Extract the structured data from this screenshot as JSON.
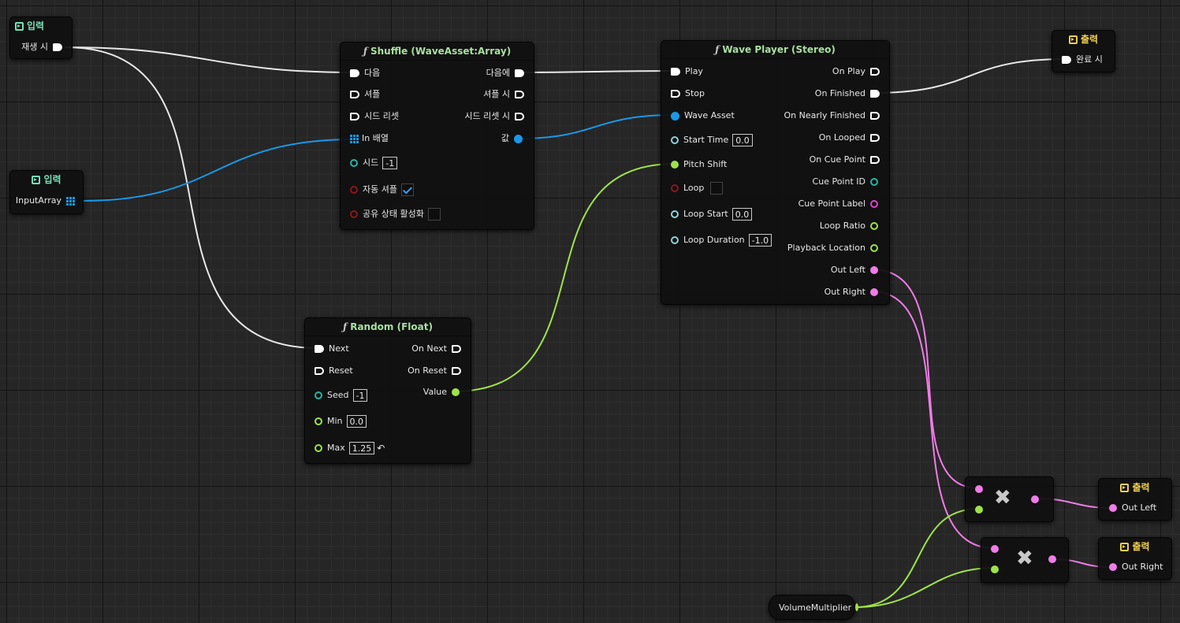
{
  "colors": {
    "exec": "#ffffff",
    "float": "#9ee24a",
    "audio": "#f07ce8",
    "wave_asset": "#1a98e8",
    "time": "#8cd2dc",
    "int": "#27b5a8",
    "bool": "#8c1818",
    "string": "#e040c8"
  },
  "input_play": {
    "title": "입력",
    "pin": "재생 시"
  },
  "input_array": {
    "title": "입력",
    "pin": "InputArray"
  },
  "shuffle": {
    "title": "Shuffle (WaveAsset:Array)",
    "in": {
      "next": "다음",
      "shuffle": "셔플",
      "reset_seed": "시드 리셋",
      "in_array": "In 배열",
      "seed": "시드",
      "seed_value": "-1",
      "auto_shuffle": "자동 셔플",
      "auto_shuffle_checked": true,
      "shared_state": "공유 상태 활성화",
      "shared_state_checked": false
    },
    "out": {
      "on_next": "다음에",
      "on_shuffle": "셔플 시",
      "on_reset_seed": "시드 리셋 시",
      "value": "값"
    }
  },
  "wave_player": {
    "title": "Wave Player (Stereo)",
    "in": {
      "play": "Play",
      "stop": "Stop",
      "wave_asset": "Wave Asset",
      "start_time": "Start Time",
      "start_time_value": "0.0",
      "pitch_shift": "Pitch Shift",
      "loop": "Loop",
      "loop_checked": false,
      "loop_start": "Loop Start",
      "loop_start_value": "0.0",
      "loop_duration": "Loop Duration",
      "loop_duration_value": "-1.0"
    },
    "out": {
      "on_play": "On Play",
      "on_finished": "On Finished",
      "on_nearly_finished": "On Nearly Finished",
      "on_looped": "On Looped",
      "on_cue_point": "On Cue Point",
      "cue_point_id": "Cue Point ID",
      "cue_point_label": "Cue Point Label",
      "loop_ratio": "Loop Ratio",
      "playback_location": "Playback Location",
      "out_left": "Out Left",
      "out_right": "Out Right"
    }
  },
  "random": {
    "title": "Random (Float)",
    "in": {
      "next": "Next",
      "reset": "Reset",
      "seed": "Seed",
      "seed_value": "-1",
      "min": "Min",
      "min_value": "0.0",
      "max": "Max",
      "max_value": "1.25"
    },
    "out": {
      "on_next": "On Next",
      "on_reset": "On Reset",
      "value": "Value"
    }
  },
  "output_finished": {
    "title": "출력",
    "pin": "완료 시"
  },
  "output_left": {
    "title": "출력",
    "pin": "Out Left"
  },
  "output_right": {
    "title": "출력",
    "pin": "Out Right"
  },
  "multiply_symbol": "✖",
  "volume_multiplier": {
    "label": "VolumeMultiplier"
  },
  "icons": {
    "input": "input-icon",
    "output": "output-icon",
    "function": "function-icon",
    "multiply": "multiply-icon",
    "array": "array-icon",
    "reset": "reset-arrow-icon",
    "check": "checkmark-icon"
  }
}
